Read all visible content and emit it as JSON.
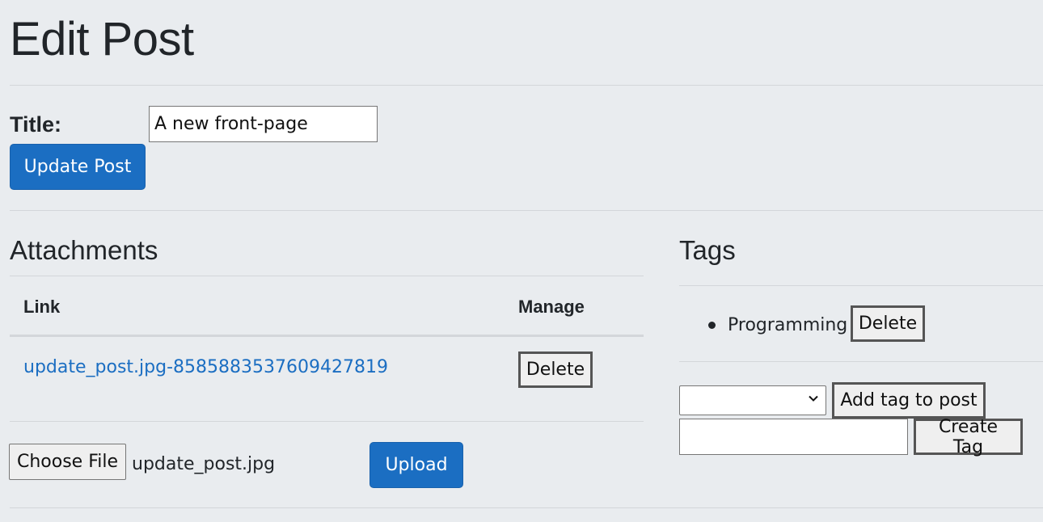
{
  "page": {
    "title": "Edit Post"
  },
  "post_form": {
    "title_label": "Title:",
    "title_value": "A new front-page",
    "update_button": "Update Post"
  },
  "attachments": {
    "heading": "Attachments",
    "columns": [
      "Link",
      "Manage"
    ],
    "rows": [
      {
        "link": "update_post.jpg-8585883537609427819",
        "action": "Delete"
      }
    ],
    "file_input": {
      "button_label": "Choose File",
      "selected_file": "update_post.jpg"
    },
    "upload_button": "Upload"
  },
  "tags": {
    "heading": "Tags",
    "items": [
      {
        "name": "Programming",
        "action": "Delete"
      }
    ],
    "tag_select_value": "",
    "add_tag_button": "Add tag to post",
    "new_tag_value": "",
    "create_tag_button": "Create Tag"
  },
  "colors": {
    "primary": "#1b6ec2",
    "background": "#e9ecef",
    "text": "#212529"
  }
}
